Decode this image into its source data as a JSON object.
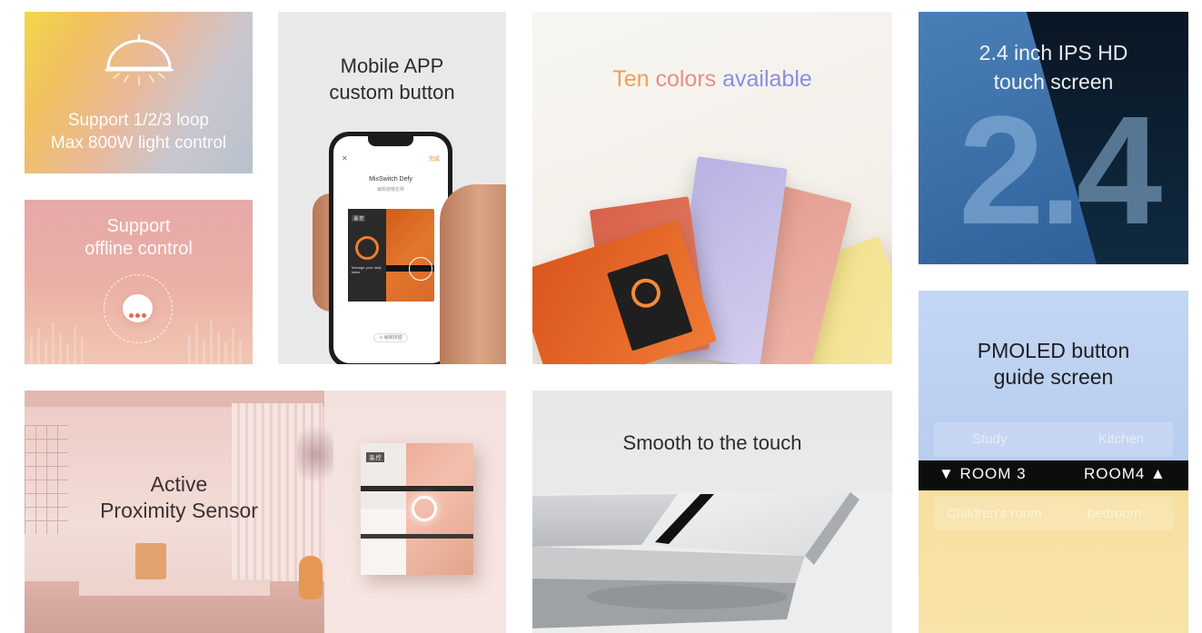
{
  "tiles": {
    "light": {
      "line1": "Support 1/2/3 loop",
      "line2": "Max 800W light control",
      "icon": "ceiling-lamp-icon"
    },
    "offline": {
      "line1": "Support",
      "line2": "offline control",
      "icon": "chat-bubble-icon"
    },
    "app": {
      "line1": "Mobile APP",
      "line2": "custom button",
      "phone": {
        "close": "✕",
        "done": "完成",
        "device_name": "MixSwitch Defy",
        "device_sub": "编辑按键名称",
        "panel_tag": "温.控",
        "panel_note": "Manage your daily tasks",
        "bottom_link": "⊙ 编辑按键"
      }
    },
    "colors": {
      "title_word1": "Ten",
      "title_word2": "colors",
      "title_word3": "available",
      "colors": [
        "#f0a24a",
        "#e59186",
        "#8a8ee0"
      ]
    },
    "screen": {
      "line1": "2.4 inch IPS HD",
      "line2": "touch screen",
      "big_number": "2.4"
    },
    "proximity": {
      "line1": "Active",
      "line2": "Proximity Sensor",
      "switch_tag": "温.控"
    },
    "smooth": {
      "title": "Smooth to the touch"
    },
    "pmoled": {
      "line1": "PMOLED button",
      "line2": "guide screen",
      "top_left": "Study",
      "top_right": "Kitchen",
      "room_left": "▼ ROOM 3",
      "room_right": "ROOM4 ▲",
      "bottom_left": "Children's room",
      "bottom_right": "bedroom"
    }
  }
}
